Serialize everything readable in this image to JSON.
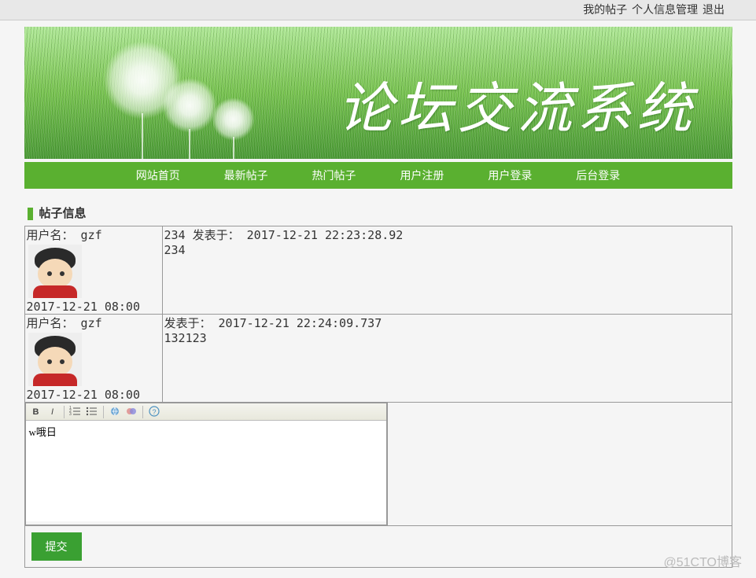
{
  "topNav": {
    "myPosts": "我的帖子",
    "profile": "个人信息管理",
    "logout": "退出"
  },
  "banner": {
    "title": "论坛交流系统"
  },
  "mainNav": {
    "home": "网站首页",
    "latest": "最新帖子",
    "hot": "热门帖子",
    "register": "用户注册",
    "login": "用户登录",
    "admin": "后台登录"
  },
  "section": {
    "title": "帖子信息"
  },
  "posts": [
    {
      "usernameLabel": "用户名：",
      "username": "gzf",
      "regDate": "2017-12-21 08:00",
      "header": "234 发表于： 2017-12-21 22:23:28.92",
      "content": "234"
    },
    {
      "usernameLabel": "用户名：",
      "username": "gzf",
      "regDate": "2017-12-21 08:00",
      "header": "发表于： 2017-12-21 22:24:09.737",
      "content": "132123"
    }
  ],
  "editor": {
    "content": "w哦日",
    "toolbar": {
      "bold": "B",
      "italic": "I",
      "olist": "ordered-list-icon",
      "ulist": "unordered-list-icon",
      "link": "link-icon",
      "image": "image-icon",
      "help": "help-icon"
    }
  },
  "submit": {
    "label": "提交"
  },
  "watermark": "@51CTO博客"
}
